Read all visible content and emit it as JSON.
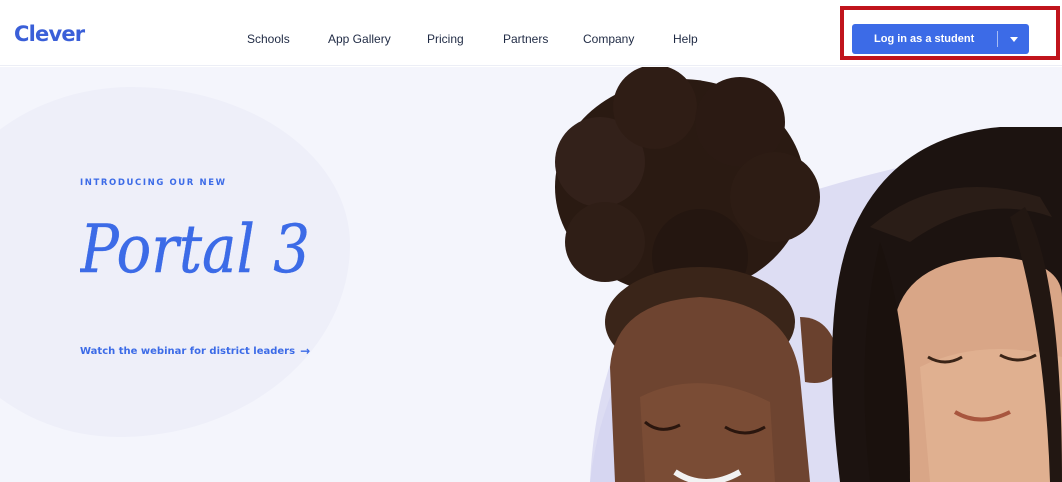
{
  "brand": {
    "logo_text": "Clever",
    "accent": "#3c6be7",
    "highlight": "#c0141c"
  },
  "nav": {
    "items": [
      {
        "label": "Schools"
      },
      {
        "label": "App Gallery"
      },
      {
        "label": "Pricing"
      },
      {
        "label": "Partners"
      },
      {
        "label": "Company"
      },
      {
        "label": "Help"
      }
    ],
    "login": {
      "label": "Log in as a student",
      "dropdown_icon": "caret-down-icon"
    }
  },
  "hero": {
    "kicker": "INTRODUCING OUR NEW",
    "title": "Portal 3",
    "link_label": "Watch the webinar for district leaders",
    "link_icon": "arrow-right-icon"
  }
}
